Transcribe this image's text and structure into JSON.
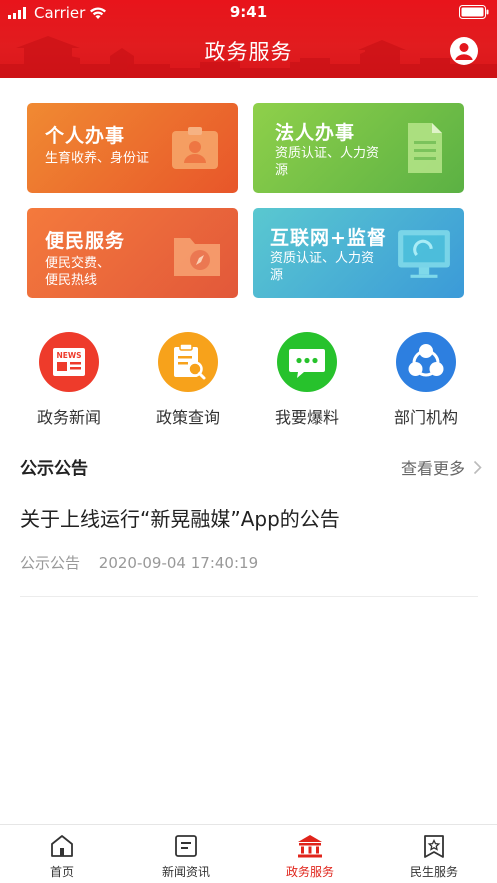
{
  "status_bar": {
    "carrier": "Carrier",
    "time": "9:41"
  },
  "header": {
    "title": "政务服务"
  },
  "service_cards": [
    {
      "title": "个人办事",
      "subtitle": "生育收养、身份证",
      "icon": "id-card-icon",
      "color": "#ec6c2e"
    },
    {
      "title": "法人办事",
      "subtitle": "资质认证、人力资源",
      "icon": "document-icon",
      "color": "#74c148"
    },
    {
      "title": "便民服务",
      "subtitle": "便民交费、便民热线",
      "icon": "folder-compass-icon",
      "color": "#eb6a3b"
    },
    {
      "title": "互联网+监督",
      "subtitle": "资质认证、人力资源",
      "icon": "monitor-icon",
      "color": "#4ab1d4"
    }
  ],
  "quick_links": [
    {
      "label": "政务新闻",
      "icon": "news-icon",
      "color": "#ee3b2b",
      "badge_text": "NEWS"
    },
    {
      "label": "政策查询",
      "icon": "policy-search-icon",
      "color": "#f7a21b"
    },
    {
      "label": "我要爆料",
      "icon": "chat-bubble-icon",
      "color": "#27c22c"
    },
    {
      "label": "部门机构",
      "icon": "organization-icon",
      "color": "#2d7fe0"
    }
  ],
  "notices": {
    "section_title": "公示公告",
    "more_label": "查看更多",
    "items": [
      {
        "title": "关于上线运行“新晃融媒”App的公告",
        "category": "公示公告",
        "datetime": "2020-09-04 17:40:19"
      }
    ]
  },
  "tab_bar": {
    "active": "政务服务",
    "active_color": "#e0241b",
    "items": [
      {
        "label": "首页",
        "icon": "home-icon"
      },
      {
        "label": "新闻资讯",
        "icon": "news-list-icon"
      },
      {
        "label": "政务服务",
        "icon": "government-building-icon"
      },
      {
        "label": "民生服务",
        "icon": "star-bookmark-icon"
      }
    ]
  }
}
